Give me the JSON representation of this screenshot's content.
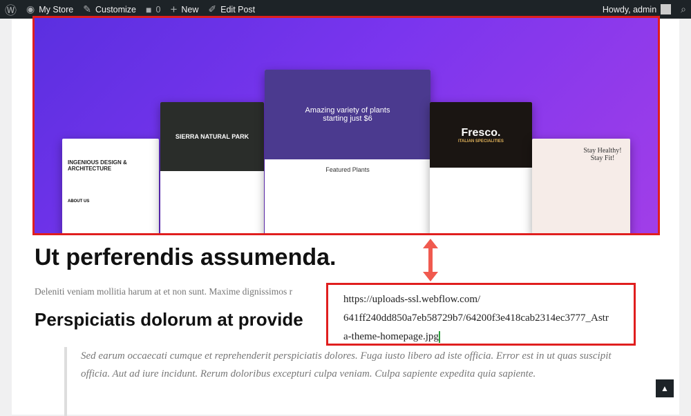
{
  "adminbar": {
    "items": [
      {
        "icon": "wordpress-icon",
        "label": ""
      },
      {
        "icon": "dashboard-icon",
        "label": "My Store"
      },
      {
        "icon": "brush-icon",
        "label": "Customize"
      },
      {
        "icon": "comment-icon",
        "label": "0"
      },
      {
        "icon": "plus-icon",
        "label": "New"
      },
      {
        "icon": "pencil-icon",
        "label": "Edit Post"
      }
    ],
    "greeting": "Howdy, admin"
  },
  "hero": {
    "cards": [
      {
        "title": "INGENIOUS DESIGN & ARCHITECTURE",
        "sub": "ABOUT US"
      },
      {
        "title": "SIERRA NATURAL PARK"
      },
      {
        "title": "Amazing variety of plants starting just $6",
        "sub": "Featured Plants"
      },
      {
        "title": "Fresco.",
        "sub": "ITALIAN SPECIALITIES"
      },
      {
        "title": "Stay Healthy! Stay Fit!"
      }
    ]
  },
  "article": {
    "title": "Ut perferendis assumenda.",
    "paragraph": "Deleniti veniam mollitia harum at et non sunt. Maxime dignissimos r",
    "subtitle": "Perspiciatis dolorum at provide",
    "quote": "Sed earum occaecati cumque et reprehenderit perspiciatis dolores. Fuga iusto libero ad iste officia. Error est in ut quas suscipit officia. Aut ad iure incidunt. Rerum doloribus excepturi culpa veniam. Culpa sapiente expedita quia sapiente."
  },
  "url_callout": {
    "line1": "https://uploads-ssl.webflow.com/",
    "line2": "641ff240dd850a7eb58729b7/64200f3e418cab2314ec3777_Astr",
    "line3": "a-theme-homepage.jpg"
  },
  "colors": {
    "highlight": "#e01e1e",
    "adminbar": "#1d2327",
    "arrow": "#f05a4f"
  }
}
